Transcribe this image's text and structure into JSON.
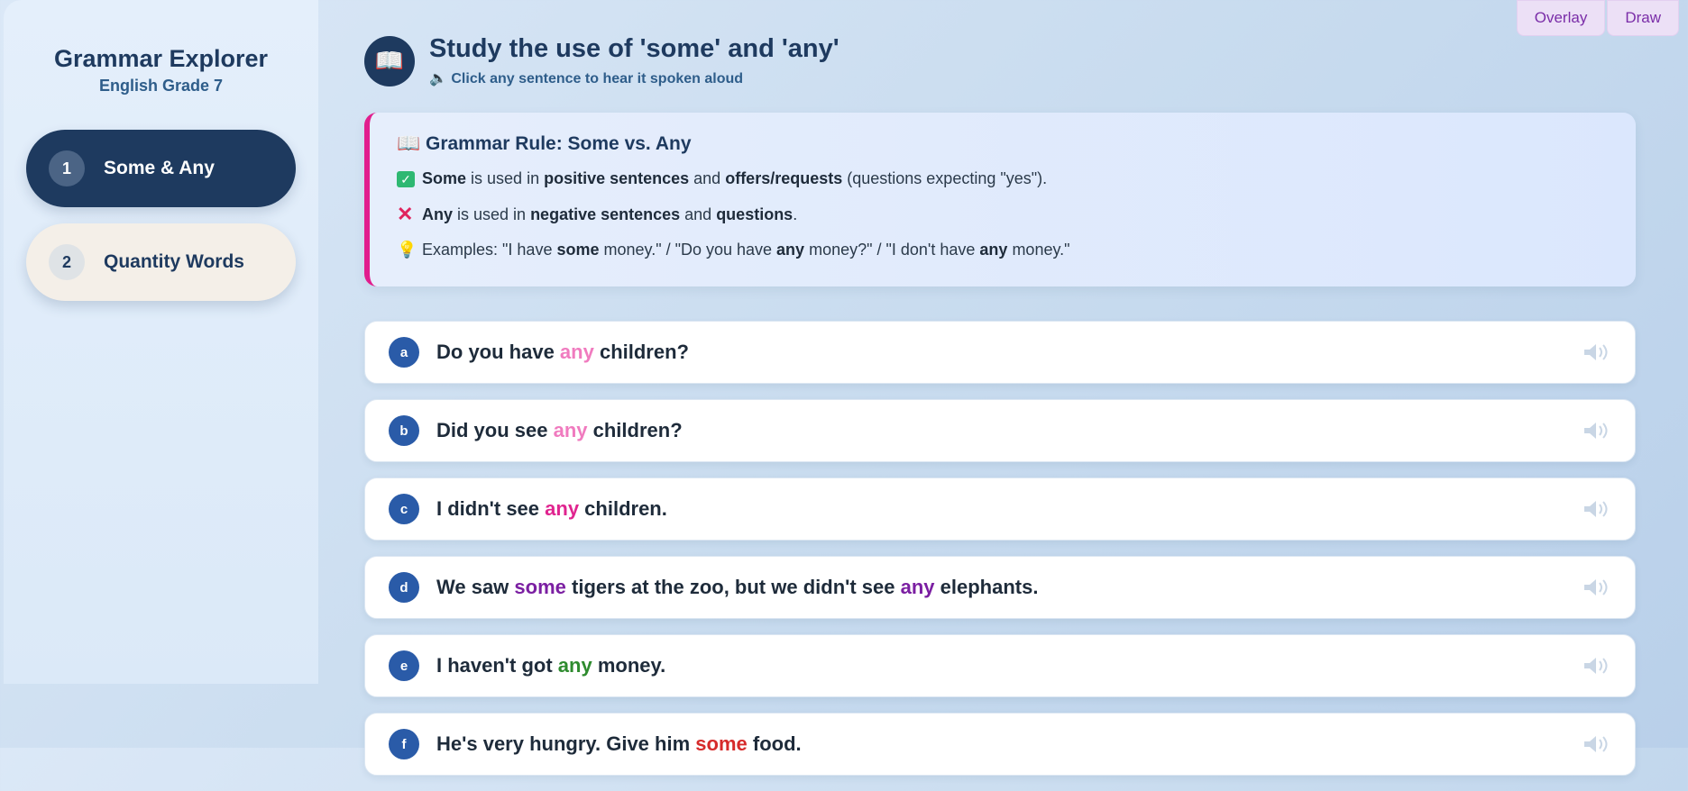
{
  "app": {
    "title": "Grammar Explorer",
    "subtitle": "English Grade 7"
  },
  "nav": [
    {
      "num": "1",
      "label": "Some & Any",
      "active": true
    },
    {
      "num": "2",
      "label": "Quantity Words",
      "active": false
    }
  ],
  "toolbar": {
    "overlay_label": "Overlay",
    "draw_label": "Draw"
  },
  "header": {
    "icon": "book-icon",
    "title": "Study the use of 'some' and 'any'",
    "subtitle": "Click any sentence to hear it spoken aloud",
    "subtitle_icon": "speaker-icon"
  },
  "rule": {
    "title": "Grammar Rule: Some vs. Any",
    "line1": {
      "a": "Some",
      "b": " is used in ",
      "c": "positive sentences",
      "d": " and ",
      "e": "offers/requests",
      "f": " (questions expecting \"yes\")."
    },
    "line2": {
      "a": "Any",
      "b": " is used in ",
      "c": "negative sentences",
      "d": " and ",
      "e": "questions",
      "f": "."
    },
    "line3": {
      "a": "Examples: \"I have ",
      "b": "some",
      "c": " money.\" / \"Do you have ",
      "d": "any",
      "e": " money?\" / \"I don't have ",
      "f": "any",
      "g": " money.\""
    }
  },
  "colors": {
    "pink": "#f07bbf",
    "magenta": "#e0248f",
    "purple": "#7b1fa2",
    "green": "#2e8b2e",
    "red": "#d62b2b",
    "navy": "#1e3a5f"
  },
  "sentences": [
    {
      "letter": "a",
      "pre": "Do you have ",
      "word": "any",
      "post": " children?",
      "color": "#f07bbf"
    },
    {
      "letter": "b",
      "pre": "Did you see ",
      "word": "any",
      "post": " children?",
      "color": "#f07bbf"
    },
    {
      "letter": "c",
      "pre": "I didn't see ",
      "word": "any",
      "post": " children.",
      "color": "#e0248f"
    },
    {
      "letter": "d",
      "pre": "We saw ",
      "word": "some",
      "mid": " tigers at the zoo, but we didn't see ",
      "word2": "any",
      "post": " elephants.",
      "color": "#7b1fa2"
    },
    {
      "letter": "e",
      "pre": "I haven't got ",
      "word": "any",
      "post": " money.",
      "color": "#2e8b2e"
    },
    {
      "letter": "f",
      "pre": "He's very hungry. Give him ",
      "word": "some",
      "post": " food.",
      "color": "#d62b2b"
    }
  ]
}
